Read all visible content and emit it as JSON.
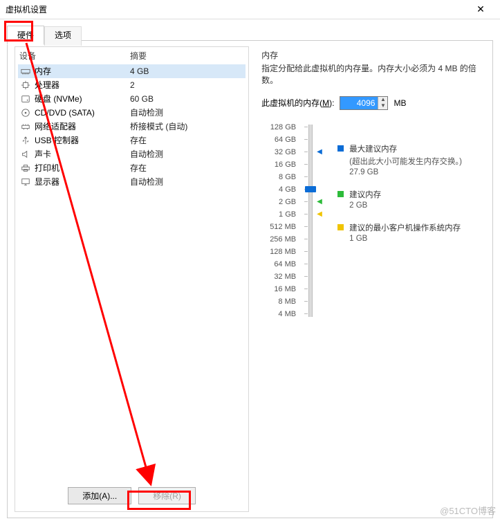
{
  "window": {
    "title": "虚拟机设置"
  },
  "tabs": {
    "hardware": "硬件",
    "options": "选项"
  },
  "headers": {
    "device": "设备",
    "summary": "摘要"
  },
  "devices": [
    {
      "icon": "memory",
      "name": "内存",
      "summary": "4 GB",
      "selected": true
    },
    {
      "icon": "cpu",
      "name": "处理器",
      "summary": "2"
    },
    {
      "icon": "disk",
      "name": "硬盘 (NVMe)",
      "summary": "60 GB"
    },
    {
      "icon": "disc",
      "name": "CD/DVD (SATA)",
      "summary": "自动检测"
    },
    {
      "icon": "net",
      "name": "网络适配器",
      "summary": "桥接模式 (自动)"
    },
    {
      "icon": "usb",
      "name": "USB 控制器",
      "summary": "存在"
    },
    {
      "icon": "sound",
      "name": "声卡",
      "summary": "自动检测"
    },
    {
      "icon": "printer",
      "name": "打印机",
      "summary": "存在"
    },
    {
      "icon": "display",
      "name": "显示器",
      "summary": "自动检测"
    }
  ],
  "buttons": {
    "add": "添加(A)...",
    "remove": "移除(R)"
  },
  "memory": {
    "group": "内存",
    "desc": "指定分配给此虚拟机的内存量。内存大小必须为 4 MB 的倍数。",
    "label_pre": "此虚拟机的内存(",
    "label_u": "M",
    "label_post": "):",
    "value": "4096",
    "unit": "MB",
    "ticks": [
      "128 GB",
      "64 GB",
      "32 GB",
      "16 GB",
      "8 GB",
      "4 GB",
      "2 GB",
      "1 GB",
      "512 MB",
      "256 MB",
      "128 MB",
      "64 MB",
      "32 MB",
      "16 MB",
      "8 MB",
      "4 MB"
    ],
    "legend": {
      "max": "最大建议内存",
      "max_sub": "(超出此大小可能发生内存交换。)",
      "max_val": "27.9 GB",
      "rec": "建议内存",
      "rec_val": "2 GB",
      "min": "建议的最小客户机操作系统内存",
      "min_val": "1 GB"
    }
  },
  "watermark": "@51CTO博客"
}
